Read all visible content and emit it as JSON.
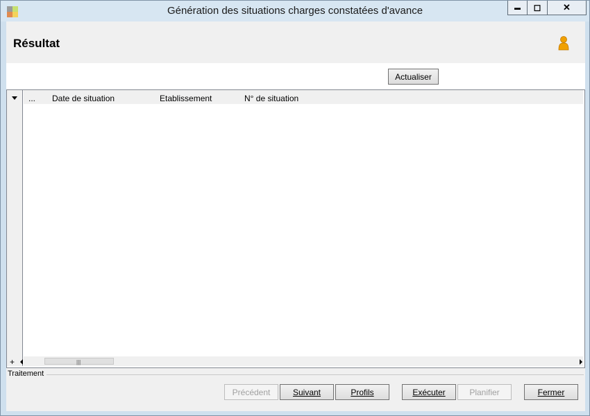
{
  "window": {
    "title": "Génération des situations charges constatées d'avance",
    "controls": {
      "minimize": "▬",
      "maximize": "◻",
      "close": "✕"
    }
  },
  "header": {
    "title": "Résultat",
    "icon": "user-icon"
  },
  "toolbar": {
    "refresh_label": "Actualiser"
  },
  "grid": {
    "columns": [
      "...",
      "Date de situation",
      "Etablissement",
      "N° de situation"
    ],
    "rows": [],
    "add_label": "+"
  },
  "footer": {
    "group_label": "Traitement",
    "buttons": {
      "previous": "Précédent",
      "next": "Suivant",
      "profiles": "Profils",
      "execute": "Exécuter",
      "schedule": "Planifier",
      "close": "Fermer"
    }
  },
  "colors": {
    "titlebar": "#d7e6f2",
    "client_bg": "#f0f0f0",
    "accent_user_icon": "#f0a000"
  }
}
